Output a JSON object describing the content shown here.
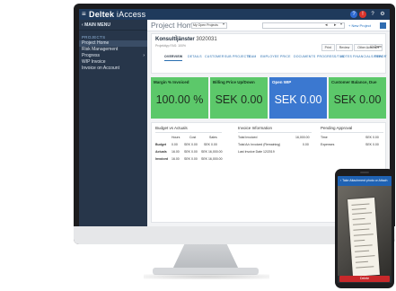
{
  "app": {
    "brand": "Deltek",
    "product": "iAccess",
    "topbar_icons": [
      {
        "name": "help-icon",
        "glyph": "?",
        "color": "#1f3a5c"
      },
      {
        "name": "alert-icon",
        "glyph": "!",
        "color": "#d9342b"
      },
      {
        "name": "info-icon",
        "glyph": "?",
        "color": "#1f3a5c"
      },
      {
        "name": "gear-icon",
        "glyph": "⚙",
        "color": "#1f3a5c"
      }
    ]
  },
  "sidebar": {
    "main_menu": "MAIN MENU",
    "section": "PROJECTS",
    "items": [
      {
        "label": "Project Home",
        "active": true
      },
      {
        "label": "Risk Management"
      },
      {
        "label": "Progress",
        "chevron": true
      },
      {
        "label": "WIP Invoice"
      },
      {
        "label": "Invoice on Account"
      }
    ]
  },
  "header": {
    "title": "Project Home",
    "project_select": "My Open Projects",
    "new_project": "+ New Project"
  },
  "project": {
    "name": "KonsultÌjänster",
    "id": "3020031",
    "subtitle": "Projekttyp FAS: 100%",
    "buttons": [
      "Print",
      "Review",
      "Other Actions ▾"
    ],
    "open_label": "Open",
    "tabs": [
      "OVERVIEW",
      "DETAILS",
      "CUSTOMER",
      "SUB PROJECTS",
      "TEAM",
      "EMPLOYEE",
      "PRICE",
      "DOCUMENTS",
      "PROGRESS/TUB",
      "NOTES",
      "FINANCIALS/TRIM",
      "REPORTS"
    ]
  },
  "tiles": [
    {
      "label": "Margin % Invoiced",
      "value": "100.00 %",
      "color": "#5cc86a"
    },
    {
      "label": "Billing Price Up/Down",
      "value": "SEK 0.00",
      "color": "#5cc86a"
    },
    {
      "label": "Open WIP",
      "value": "SEK 0.00",
      "color": "#3b78d0"
    },
    {
      "label": "Customer Balance, Due",
      "value": "SEK 0.00",
      "color": "#5cc86a"
    }
  ],
  "budget": {
    "title": "Budget vs Actuals",
    "columns": [
      "Hours",
      "Cost",
      "Sales"
    ],
    "rows": [
      {
        "label": "Budget",
        "hours": "0.00",
        "cost": "SEK 0.00",
        "sales": "SEK 0.00"
      },
      {
        "label": "Actuals",
        "hours": "16.00",
        "cost": "SEK 0.00",
        "sales": "SEK 16,000.00"
      },
      {
        "label": "Invoiced",
        "hours": "16.00",
        "cost": "SEK 0.00",
        "sales": "SEK 16,000.00"
      }
    ]
  },
  "invoice": {
    "title": "Invoice Information",
    "rows": [
      {
        "label": "Total Invoiced",
        "value": "16,000.00"
      },
      {
        "label": "Total A/c Invoiced (Remaining)",
        "value": "0.00"
      },
      {
        "label": "Last Invoice Date",
        "value": "12/2019"
      }
    ]
  },
  "pending": {
    "title": "Pending Approval",
    "rows": [
      {
        "label": "Time",
        "value": "SEK 0.00"
      },
      {
        "label": "Expenses",
        "value": "SEK 0.00"
      }
    ]
  },
  "phone": {
    "header": "‹  Take Attachment photo or Attach",
    "delete": "Delete"
  }
}
